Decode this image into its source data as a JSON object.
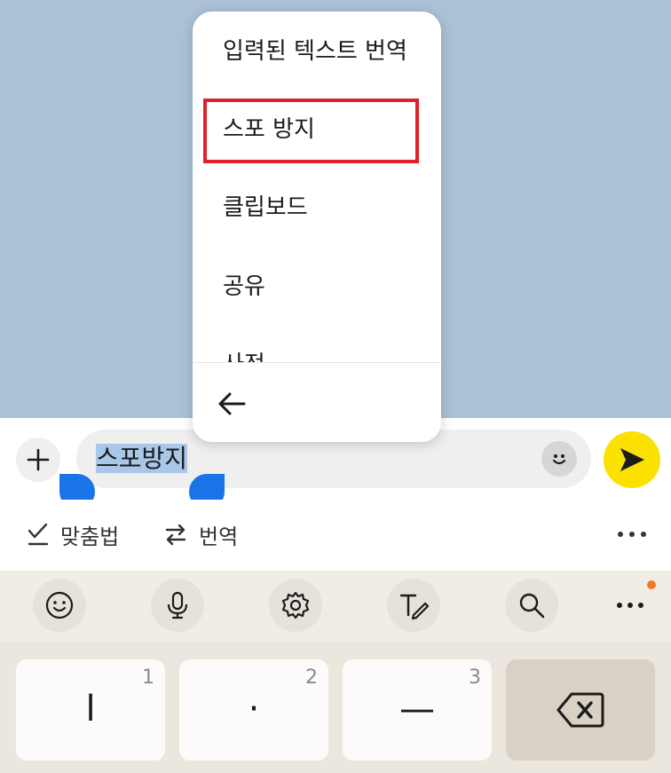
{
  "popup_menu": {
    "items": [
      {
        "label": "입력된 텍스트 번역"
      },
      {
        "label": "스포 방지"
      },
      {
        "label": "클립보드"
      },
      {
        "label": "공유"
      },
      {
        "label": "사전"
      }
    ],
    "back_icon": "arrow-left-icon",
    "highlighted_item": "스포 방지",
    "highlight_color": "#e0202a"
  },
  "composer": {
    "text": "스포방지",
    "selection_color": "#a9c7e8",
    "handle_color": "#1a73e8",
    "send_color": "#fae100"
  },
  "toolbar": {
    "spell_label": "맞춤법",
    "translate_label": "번역"
  },
  "keyboard": {
    "keys": [
      {
        "glyph": "l",
        "number": "1"
      },
      {
        "glyph": "·",
        "number": "2"
      },
      {
        "glyph": "—",
        "number": "3"
      }
    ],
    "notification_dot_color": "#f07a2b"
  }
}
